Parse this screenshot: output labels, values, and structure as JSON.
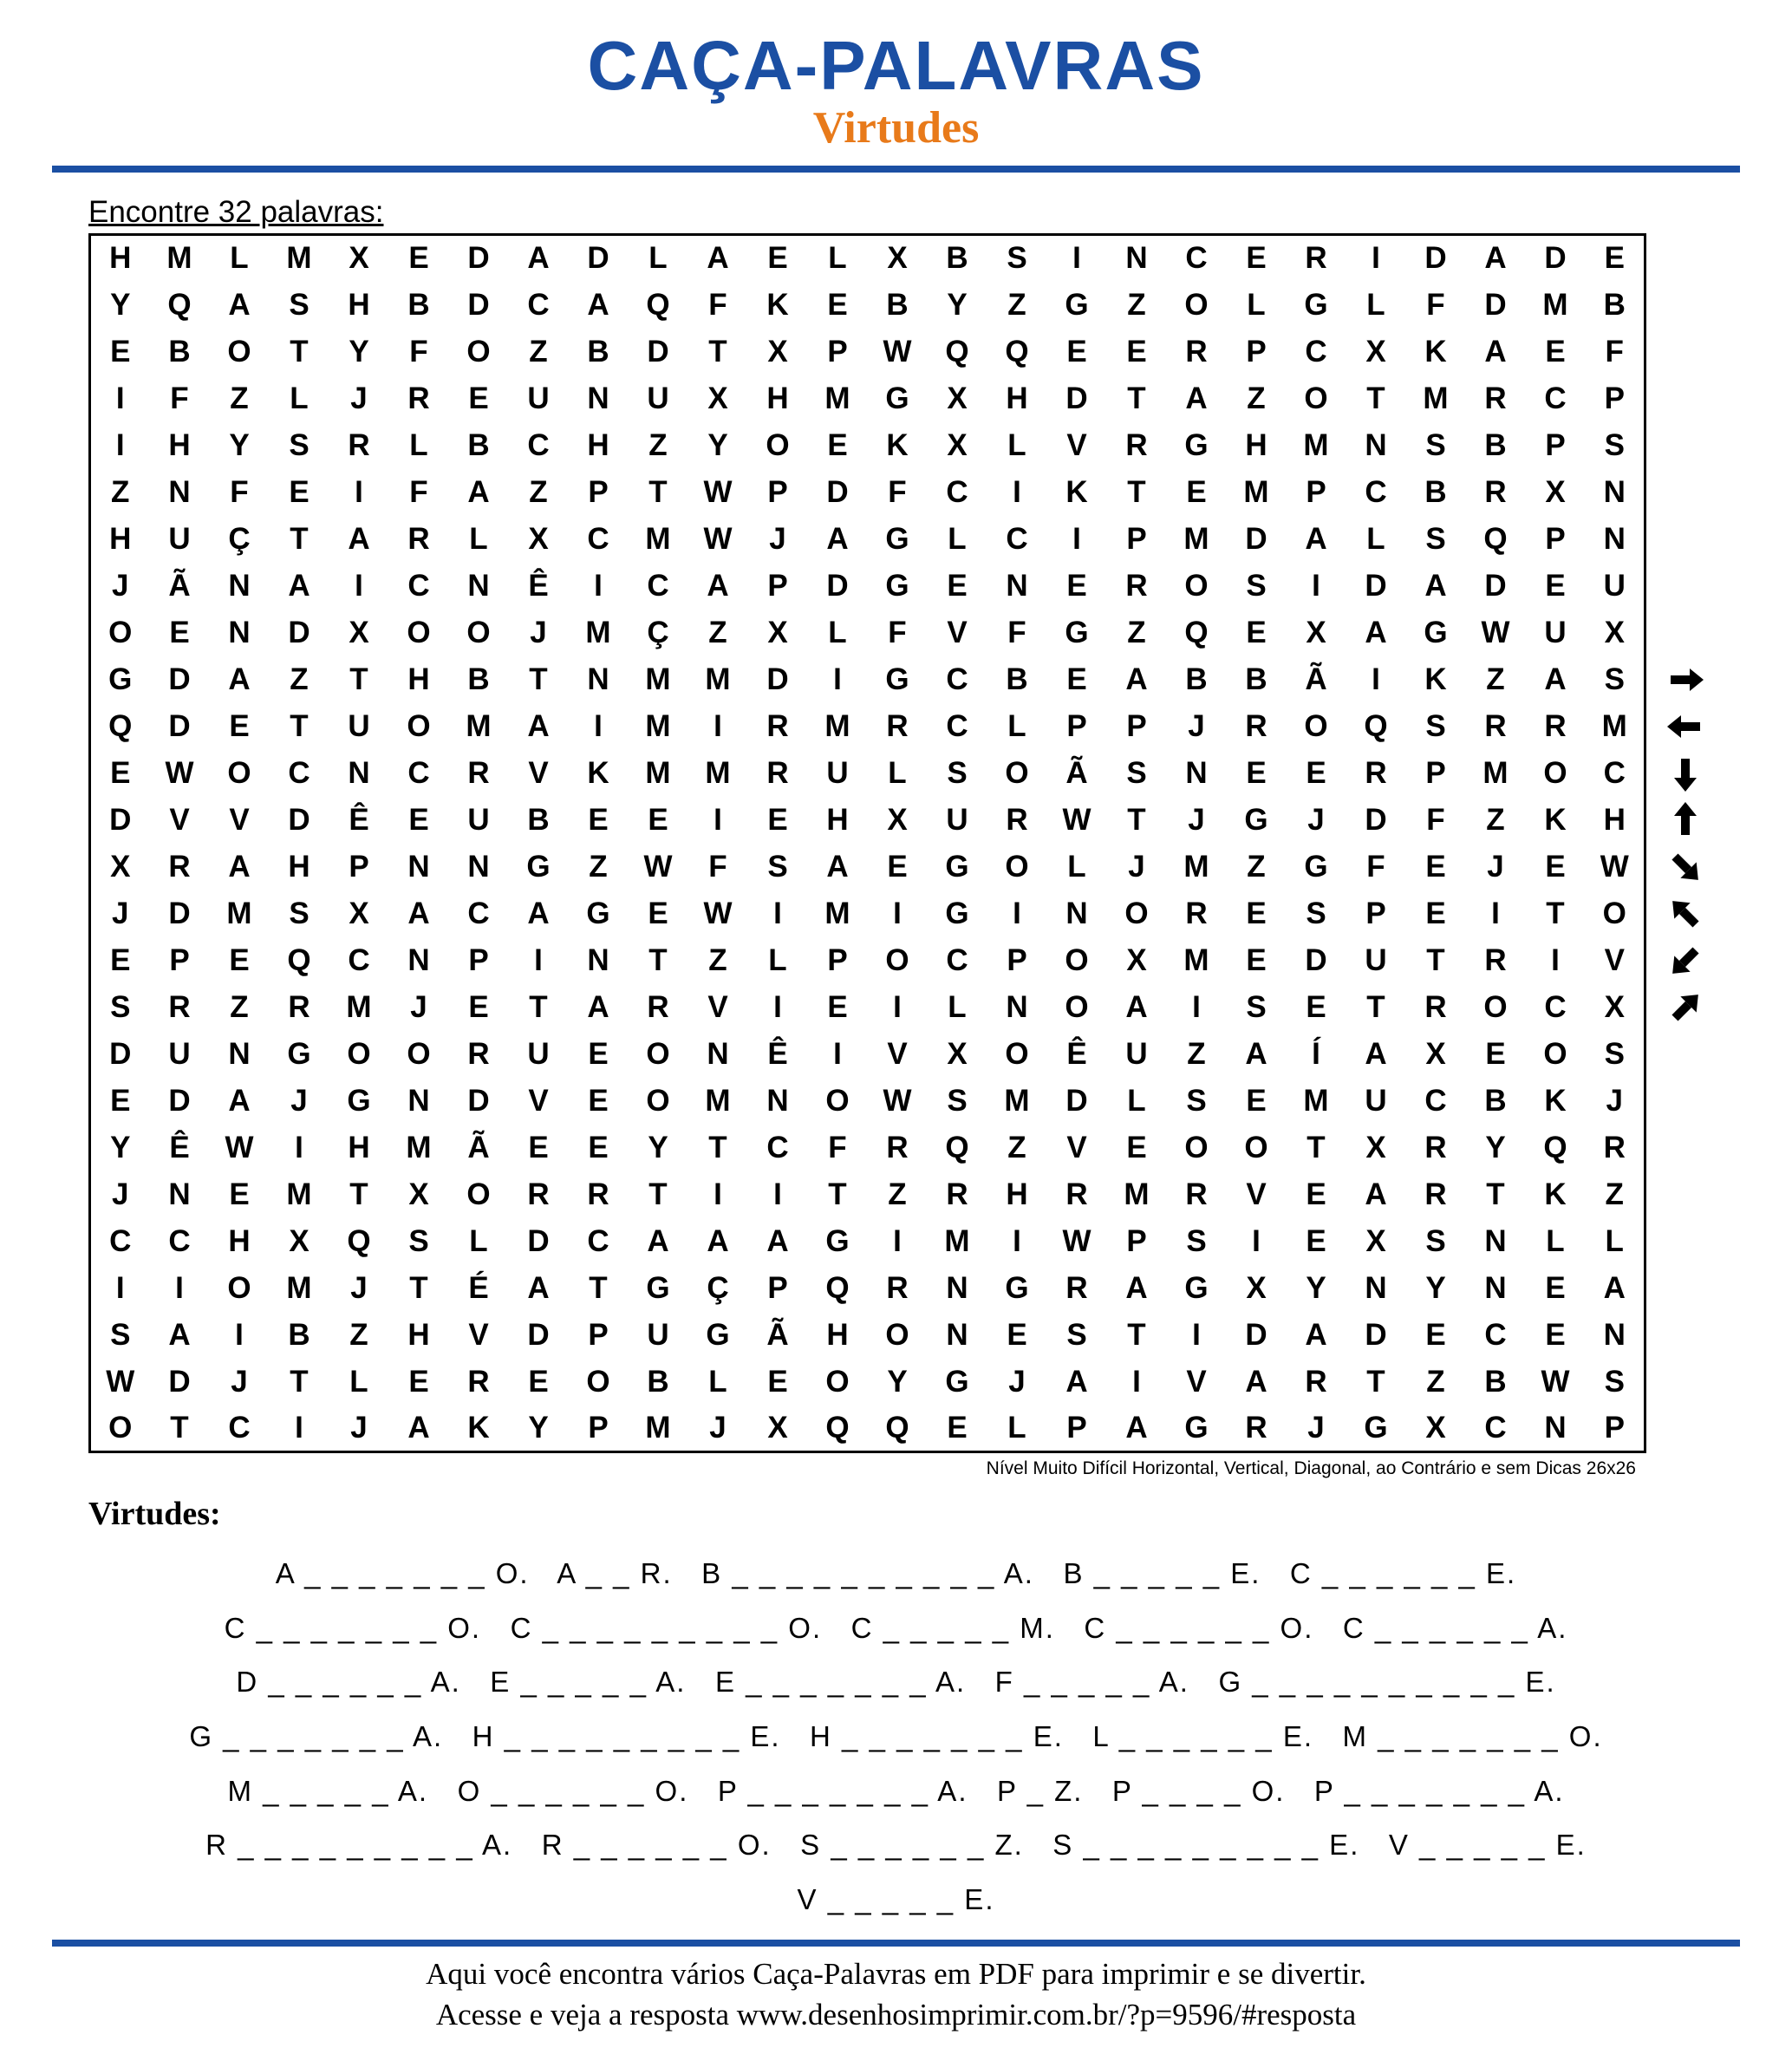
{
  "title": "CAÇA-PALAVRAS",
  "subtitle": "Virtudes",
  "instruction": "Encontre 32 palavras:",
  "grid": [
    [
      "H",
      "M",
      "L",
      "M",
      "X",
      "E",
      "D",
      "A",
      "D",
      "L",
      "A",
      "E",
      "L",
      "X",
      "B",
      "S",
      "I",
      "N",
      "C",
      "E",
      "R",
      "I",
      "D",
      "A",
      "D",
      "E"
    ],
    [
      "Y",
      "Q",
      "A",
      "S",
      "H",
      "B",
      "D",
      "C",
      "A",
      "Q",
      "F",
      "K",
      "E",
      "B",
      "Y",
      "Z",
      "G",
      "Z",
      "O",
      "L",
      "G",
      "L",
      "F",
      "D",
      "M",
      "B"
    ],
    [
      "E",
      "B",
      "O",
      "T",
      "Y",
      "F",
      "O",
      "Z",
      "B",
      "D",
      "T",
      "X",
      "P",
      "W",
      "Q",
      "Q",
      "E",
      "E",
      "R",
      "P",
      "C",
      "X",
      "K",
      "A",
      "E",
      "F"
    ],
    [
      "I",
      "F",
      "Z",
      "L",
      "J",
      "R",
      "E",
      "U",
      "N",
      "U",
      "X",
      "H",
      "M",
      "G",
      "X",
      "H",
      "D",
      "T",
      "A",
      "Z",
      "O",
      "T",
      "M",
      "R",
      "C",
      "P"
    ],
    [
      "I",
      "H",
      "Y",
      "S",
      "R",
      "L",
      "B",
      "C",
      "H",
      "Z",
      "Y",
      "O",
      "E",
      "K",
      "X",
      "L",
      "V",
      "R",
      "G",
      "H",
      "M",
      "N",
      "S",
      "B",
      "P",
      "S"
    ],
    [
      "Z",
      "N",
      "F",
      "E",
      "I",
      "F",
      "A",
      "Z",
      "P",
      "T",
      "W",
      "P",
      "D",
      "F",
      "C",
      "I",
      "K",
      "T",
      "E",
      "M",
      "P",
      "C",
      "B",
      "R",
      "X",
      "N"
    ],
    [
      "H",
      "U",
      "Ç",
      "T",
      "A",
      "R",
      "L",
      "X",
      "C",
      "M",
      "W",
      "J",
      "A",
      "G",
      "L",
      "C",
      "I",
      "P",
      "M",
      "D",
      "A",
      "L",
      "S",
      "Q",
      "P",
      "N"
    ],
    [
      "J",
      "Ã",
      "N",
      "A",
      "I",
      "C",
      "N",
      "Ê",
      "I",
      "C",
      "A",
      "P",
      "D",
      "G",
      "E",
      "N",
      "E",
      "R",
      "O",
      "S",
      "I",
      "D",
      "A",
      "D",
      "E",
      "U"
    ],
    [
      "O",
      "E",
      "N",
      "D",
      "X",
      "O",
      "O",
      "J",
      "M",
      "Ç",
      "Z",
      "X",
      "L",
      "F",
      "V",
      "F",
      "G",
      "Z",
      "Q",
      "E",
      "X",
      "A",
      "G",
      "W",
      "U",
      "X"
    ],
    [
      "G",
      "D",
      "A",
      "Z",
      "T",
      "H",
      "B",
      "T",
      "N",
      "M",
      "M",
      "D",
      "I",
      "G",
      "C",
      "B",
      "E",
      "A",
      "B",
      "B",
      "Ã",
      "I",
      "K",
      "Z",
      "A",
      "S"
    ],
    [
      "Q",
      "D",
      "E",
      "T",
      "U",
      "O",
      "M",
      "A",
      "I",
      "M",
      "I",
      "R",
      "M",
      "R",
      "C",
      "L",
      "P",
      "P",
      "J",
      "R",
      "O",
      "Q",
      "S",
      "R",
      "R",
      "M"
    ],
    [
      "E",
      "W",
      "O",
      "C",
      "N",
      "C",
      "R",
      "V",
      "K",
      "M",
      "M",
      "R",
      "U",
      "L",
      "S",
      "O",
      "Ã",
      "S",
      "N",
      "E",
      "E",
      "R",
      "P",
      "M",
      "O",
      "C"
    ],
    [
      "D",
      "V",
      "V",
      "D",
      "Ê",
      "E",
      "U",
      "B",
      "E",
      "E",
      "I",
      "E",
      "H",
      "X",
      "U",
      "R",
      "W",
      "T",
      "J",
      "G",
      "J",
      "D",
      "F",
      "Z",
      "K",
      "H"
    ],
    [
      "X",
      "R",
      "A",
      "H",
      "P",
      "N",
      "N",
      "G",
      "Z",
      "W",
      "F",
      "S",
      "A",
      "E",
      "G",
      "O",
      "L",
      "J",
      "M",
      "Z",
      "G",
      "F",
      "E",
      "J",
      "E",
      "W"
    ],
    [
      "J",
      "D",
      "M",
      "S",
      "X",
      "A",
      "C",
      "A",
      "G",
      "E",
      "W",
      "I",
      "M",
      "I",
      "G",
      "I",
      "N",
      "O",
      "R",
      "E",
      "S",
      "P",
      "E",
      "I",
      "T",
      "O"
    ],
    [
      "E",
      "P",
      "E",
      "Q",
      "C",
      "N",
      "P",
      "I",
      "N",
      "T",
      "Z",
      "L",
      "P",
      "O",
      "C",
      "P",
      "O",
      "X",
      "M",
      "E",
      "D",
      "U",
      "T",
      "R",
      "I",
      "V"
    ],
    [
      "S",
      "R",
      "Z",
      "R",
      "M",
      "J",
      "E",
      "T",
      "A",
      "R",
      "V",
      "I",
      "E",
      "I",
      "L",
      "N",
      "O",
      "A",
      "I",
      "S",
      "E",
      "T",
      "R",
      "O",
      "C",
      "X"
    ],
    [
      "D",
      "U",
      "N",
      "G",
      "O",
      "O",
      "R",
      "U",
      "E",
      "O",
      "N",
      "Ê",
      "I",
      "V",
      "X",
      "O",
      "Ê",
      "U",
      "Z",
      "A",
      "Í",
      "A",
      "X",
      "E",
      "O",
      "S"
    ],
    [
      "E",
      "D",
      "A",
      "J",
      "G",
      "N",
      "D",
      "V",
      "E",
      "O",
      "M",
      "N",
      "O",
      "W",
      "S",
      "M",
      "D",
      "L",
      "S",
      "E",
      "M",
      "U",
      "C",
      "B",
      "K",
      "J"
    ],
    [
      "Y",
      "Ê",
      "W",
      "I",
      "H",
      "M",
      "Ã",
      "E",
      "E",
      "Y",
      "T",
      "C",
      "F",
      "R",
      "Q",
      "Z",
      "V",
      "E",
      "O",
      "O",
      "T",
      "X",
      "R",
      "Y",
      "Q",
      "R"
    ],
    [
      "J",
      "N",
      "E",
      "M",
      "T",
      "X",
      "O",
      "R",
      "R",
      "T",
      "I",
      "I",
      "T",
      "Z",
      "R",
      "H",
      "R",
      "M",
      "R",
      "V",
      "E",
      "A",
      "R",
      "T",
      "K",
      "Z"
    ],
    [
      "C",
      "C",
      "H",
      "X",
      "Q",
      "S",
      "L",
      "D",
      "C",
      "A",
      "A",
      "A",
      "G",
      "I",
      "M",
      "I",
      "W",
      "P",
      "S",
      "I",
      "E",
      "X",
      "S",
      "N",
      "L",
      "L"
    ],
    [
      "I",
      "I",
      "O",
      "M",
      "J",
      "T",
      "É",
      "A",
      "T",
      "G",
      "Ç",
      "P",
      "Q",
      "R",
      "N",
      "G",
      "R",
      "A",
      "G",
      "X",
      "Y",
      "N",
      "Y",
      "N",
      "E",
      "A"
    ],
    [
      "S",
      "A",
      "I",
      "B",
      "Z",
      "H",
      "V",
      "D",
      "P",
      "U",
      "G",
      "Ã",
      "H",
      "O",
      "N",
      "E",
      "S",
      "T",
      "I",
      "D",
      "A",
      "D",
      "E",
      "C",
      "E",
      "N"
    ],
    [
      "W",
      "D",
      "J",
      "T",
      "L",
      "E",
      "R",
      "E",
      "O",
      "B",
      "L",
      "E",
      "O",
      "Y",
      "G",
      "J",
      "A",
      "I",
      "V",
      "A",
      "R",
      "T",
      "Z",
      "B",
      "W",
      "S"
    ],
    [
      "O",
      "T",
      "C",
      "I",
      "J",
      "A",
      "K",
      "Y",
      "P",
      "M",
      "J",
      "X",
      "Q",
      "Q",
      "E",
      "L",
      "P",
      "A",
      "G",
      "R",
      "J",
      "G",
      "X",
      "C",
      "N",
      "P"
    ]
  ],
  "arrow_hints": [
    "right",
    "left",
    "down",
    "up",
    "down-right",
    "up-left",
    "down-left",
    "up-right"
  ],
  "difficulty_note": "Nível Muito Difícil Horizontal, Vertical, Diagonal, ao Contrário e sem Dicas 26x26",
  "list_title": "Virtudes:",
  "word_hints": [
    "A _ _ _ _ _ _ _ O.   A _ _ R.   B _ _ _ _ _ _ _ _ _ _ A.   B _ _ _ _ _ E.   C _ _ _ _ _ _ E.",
    "C _ _ _ _ _ _ _ O.   C _ _ _ _ _ _ _ _ _ O.   C _ _ _ _ _ M.   C _ _ _ _ _ _ O.   C _ _ _ _ _ _ A.",
    "D _ _ _ _ _ _ A.   E _ _ _ _ _ A.   E _ _ _ _ _ _ _ A.   F _ _ _ _ _ A.   G _ _ _ _ _ _ _ _ _ _ E.",
    "G _ _ _ _ _ _ _ A.   H _ _ _ _ _ _ _ _ _ E.   H _ _ _ _ _ _ _ E.   L _ _ _ _ _ _ E.   M _ _ _ _ _ _ _ O.",
    "M _ _ _ _ _ A.   O _ _ _ _ _ _ O.   P _ _ _ _ _ _ _ A.   P _ Z.   P _ _ _ _ O.   P _ _ _ _ _ _ _ A.",
    "R _ _ _ _ _ _ _ _ _ A.   R _ _ _ _ _ _ O.   S _ _ _ _ _ _ Z.   S _ _ _ _ _ _ _ _ _ E.   V _ _ _ _ _ E.",
    "V _ _ _ _ _ E."
  ],
  "footer_line1": "Aqui você encontra vários Caça-Palavras em PDF para imprimir e se divertir.",
  "footer_line2": "Acesse e veja a resposta  www.desenhosimprimir.com.br/?p=9596/#resposta"
}
